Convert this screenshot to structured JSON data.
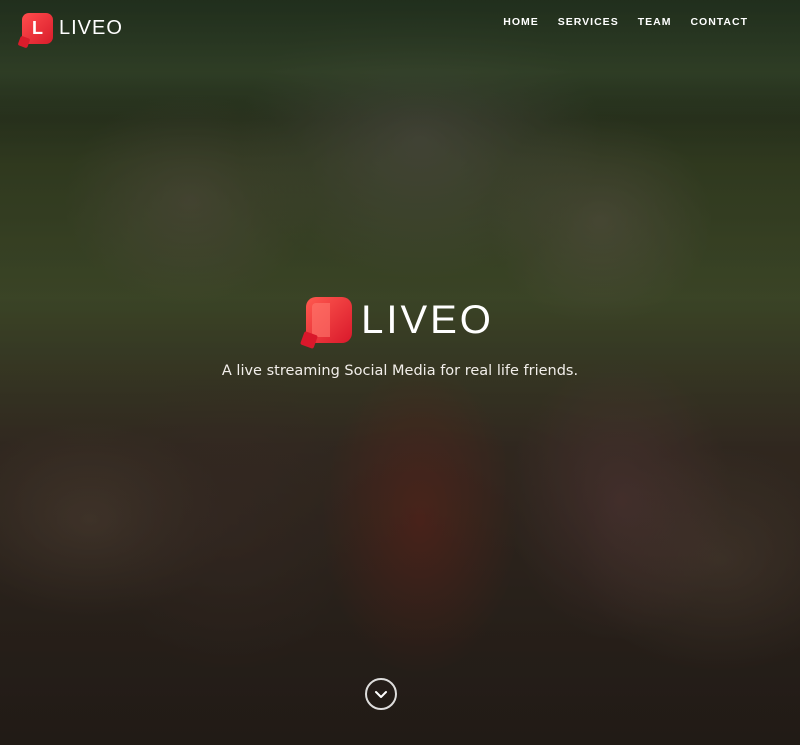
{
  "brand": {
    "name": "LIVEO",
    "mark_letter": "L",
    "accent": "#e8262f"
  },
  "nav": {
    "items": [
      {
        "label": "HOME"
      },
      {
        "label": "SERVICES"
      },
      {
        "label": "TEAM"
      },
      {
        "label": "CONTACT"
      }
    ]
  },
  "hero": {
    "title": "LIVEO",
    "tagline": "A live streaming Social Media for real life friends.",
    "scroll_icon": "chevron-down-icon"
  }
}
